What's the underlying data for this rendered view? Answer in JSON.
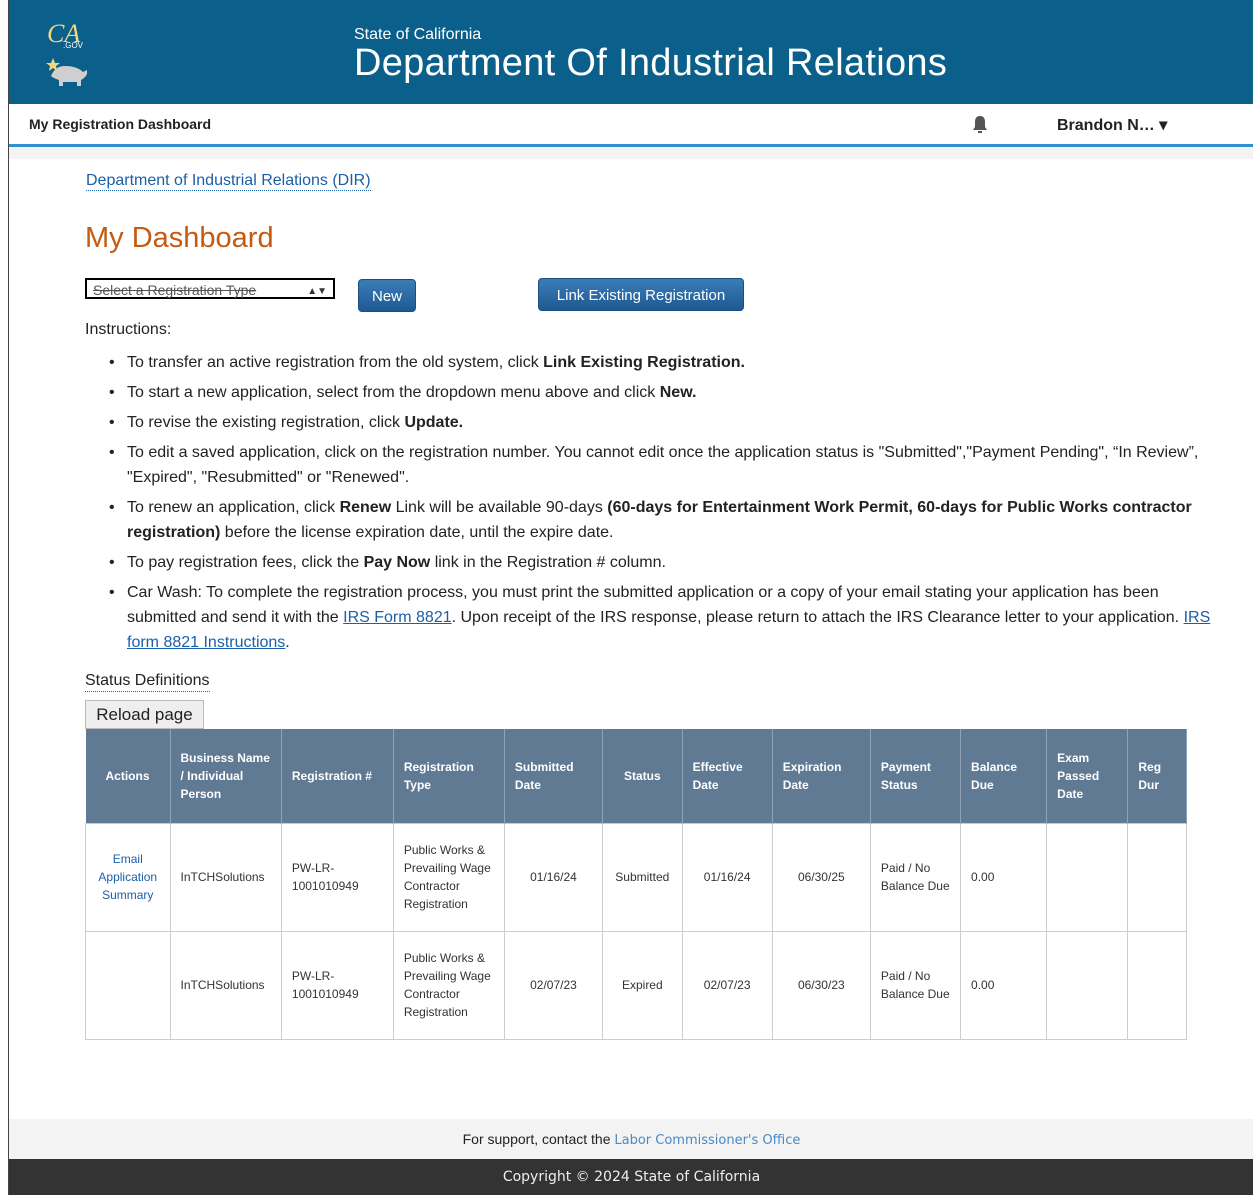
{
  "header": {
    "logo_text": "CA.GOV",
    "state": "State of California",
    "department": "Department Of Industrial Relations"
  },
  "navbar": {
    "title": "My Registration Dashboard",
    "user": "Brandon N… ▾"
  },
  "breadcrumb": "Department of Industrial Relations (DIR)",
  "page_title": "My Dashboard",
  "controls": {
    "select_placeholder": "Select a Registration Type",
    "new_label": "New",
    "link_label": "Link Existing Registration"
  },
  "instructions": {
    "label": "Instructions:",
    "items": [
      {
        "pre": "To transfer an active registration from the old system, click ",
        "bold": "Link Existing Registration."
      },
      {
        "pre": "To start a new application, select from the dropdown menu above and click ",
        "bold": "New."
      },
      {
        "pre": "To revise the existing registration, click ",
        "bold": "Update."
      },
      {
        "text": "To edit a saved application, click on the registration number. You cannot edit once the application status is \"Submitted\",\"Payment Pending\", “In Review”, \"Expired\", \"Resubmitted\" or \"Renewed\"."
      },
      {
        "pre": "To renew an application, click ",
        "b1": "Renew",
        "mid": " Link will be available 90-days ",
        "b2": "(60-days for Entertainment Work Permit, 60-days for Public Works contractor registration)",
        "post": " before the license expiration date, until the expire date."
      },
      {
        "pre": "To pay registration fees, click the ",
        "b1": "Pay Now",
        "post": " link in the Registration # column."
      },
      {
        "pre": "Car Wash: To complete the registration process, you must print the submitted application or a copy of your email stating your application has been submitted and send it with the ",
        "link1": "IRS Form 8821",
        "mid": ". Upon receipt of the IRS response, please return to attach the IRS Clearance letter to your application. ",
        "link2": "IRS form 8821 Instructions",
        "post": "."
      }
    ]
  },
  "status_definitions": "Status Definitions",
  "reload": "Reload page",
  "table": {
    "headers": [
      "Actions",
      "Business Name / Individual Person",
      "Registration #",
      "Registration Type",
      "Submitted Date",
      "Status",
      "Effective Date",
      "Expiration Date",
      "Payment Status",
      "Balance Due",
      "Exam Passed Date",
      "Reg Dur"
    ],
    "rows": [
      {
        "action": "Email Application Summary",
        "business": "InTCHSolutions",
        "reg_no": "PW-LR-1001010949",
        "type": "Public Works & Prevailing Wage Contractor Registration",
        "submitted": "01/16/24",
        "status": "Submitted",
        "effective": "01/16/24",
        "expiration": "06/30/25",
        "payment": "Paid / No Balance Due",
        "balance": "0.00",
        "exam": "",
        "dur": ""
      },
      {
        "action": "",
        "business": "InTCHSolutions",
        "reg_no": "PW-LR-1001010949",
        "type": "Public Works & Prevailing Wage Contractor Registration",
        "submitted": "02/07/23",
        "status": "Expired",
        "effective": "02/07/23",
        "expiration": "06/30/23",
        "payment": "Paid / No Balance Due",
        "balance": "0.00",
        "exam": "",
        "dur": ""
      }
    ]
  },
  "footer": {
    "support_pre": "For support, contact the ",
    "support_link": "Labor Commissioner's Office",
    "copyright": "Copyright © 2024 State of California"
  },
  "colors": {
    "header_bg": "#0a5f8b",
    "title": "#c55a11",
    "link": "#1a5fa8",
    "table_header": "#607a94"
  }
}
